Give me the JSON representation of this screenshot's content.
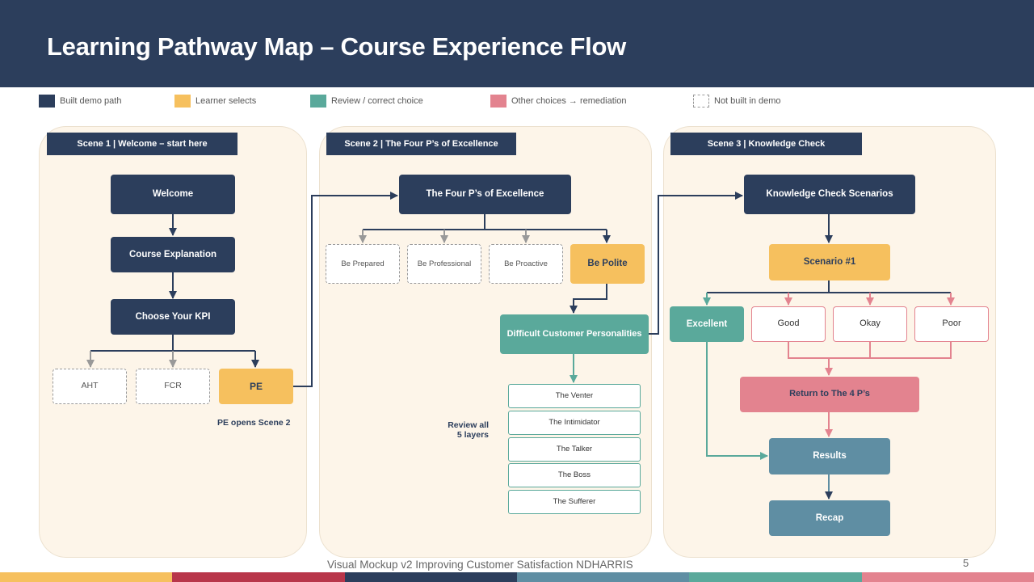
{
  "title": "Learning Pathway Map – Course Experience Flow",
  "legend": [
    {
      "label": "Built demo path",
      "color": "#2c3e5c"
    },
    {
      "label": "Learner selects",
      "color": "#f6c05e"
    },
    {
      "label": "Review / correct choice",
      "color": "#5aa99b"
    },
    {
      "label": "Other choices → remediation",
      "color": "#e3838f"
    },
    {
      "label": "Not built in demo",
      "color": "dashed"
    }
  ],
  "scene1": {
    "tag": "Scene 1  |  Welcome –  start here",
    "welcome": "Welcome",
    "course_explanation": "Course Explanation",
    "choose_kpi": "Choose Your KPI",
    "aht": "AHT",
    "fcr": "FCR",
    "pe": "PE",
    "note": "PE opens Scene 2"
  },
  "scene2": {
    "tag": "Scene 2  |  The Four P’s of Excellence",
    "four_ps": "The Four P’s of Excellence",
    "be_prepared": "Be Prepared",
    "be_professional": "Be Professional",
    "be_proactive": "Be Proactive",
    "be_polite": "Be Polite",
    "difficult": "Difficult Customer Personalities",
    "review_note_line1": "Review all",
    "review_note_line2": "5 layers",
    "personalities": [
      "The Venter",
      "The Intimidator",
      "The Talker",
      "The Boss",
      "The Sufferer"
    ]
  },
  "scene3": {
    "tag": "Scene 3  |  Knowledge Check",
    "kc": "Knowledge Check Scenarios",
    "scenario": "Scenario #1",
    "excellent": "Excellent",
    "good": "Good",
    "okay": "Okay",
    "poor": "Poor",
    "return": "Return to The 4 P’s",
    "results": "Results",
    "recap": "Recap"
  },
  "footer": {
    "text": "Visual Mockup v2  Improving Customer Satisfaction NDHARRIS",
    "page": "5"
  },
  "bottom_bar_colors": [
    "#f6c05e",
    "#b8364a",
    "#2c3e5c",
    "#5f8ea3",
    "#5aa99b",
    "#e3838f"
  ]
}
